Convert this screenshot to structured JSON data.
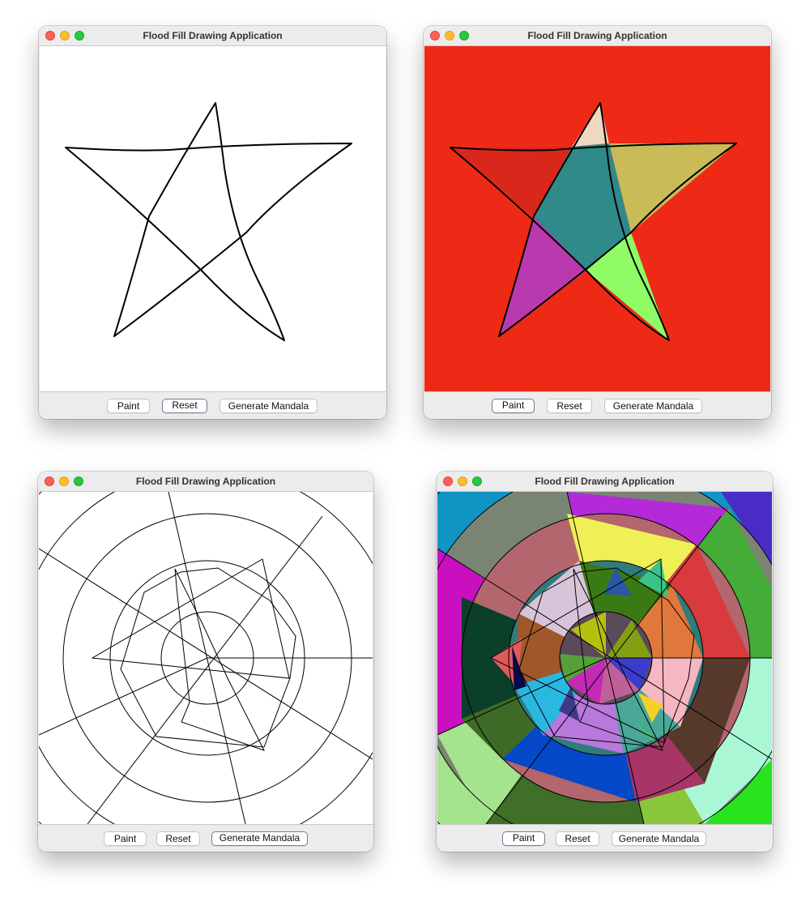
{
  "windows": [
    {
      "id": "w1",
      "title": "Flood Fill Drawing Application",
      "buttons": {
        "paint": "Paint",
        "reset": "Reset",
        "mandala": "Generate Mandala"
      }
    },
    {
      "id": "w2",
      "title": "Flood Fill Drawing Application",
      "buttons": {
        "paint": "Paint",
        "reset": "Reset",
        "mandala": "Generate Mandala"
      }
    },
    {
      "id": "w3",
      "title": "Flood Fill Drawing Application",
      "buttons": {
        "paint": "Paint",
        "reset": "Reset",
        "mandala": "Generate Mandala"
      }
    },
    {
      "id": "w4",
      "title": "Flood Fill Drawing Application",
      "buttons": {
        "paint": "Paint",
        "reset": "Reset",
        "mandala": "Generate Mandala"
      }
    }
  ],
  "colors": {
    "background_fill": "#ee2a16",
    "star_tip_top": "#f0d8c0",
    "star_tip_left": "#d9271c",
    "star_tip_right": "#c8bb58",
    "star_center": "#2f8a8a",
    "star_tip_lower_left": "#b93aae",
    "star_tip_lower_right": "#8ffc66",
    "stroke": "#000000",
    "canvas": "#ffffff"
  }
}
